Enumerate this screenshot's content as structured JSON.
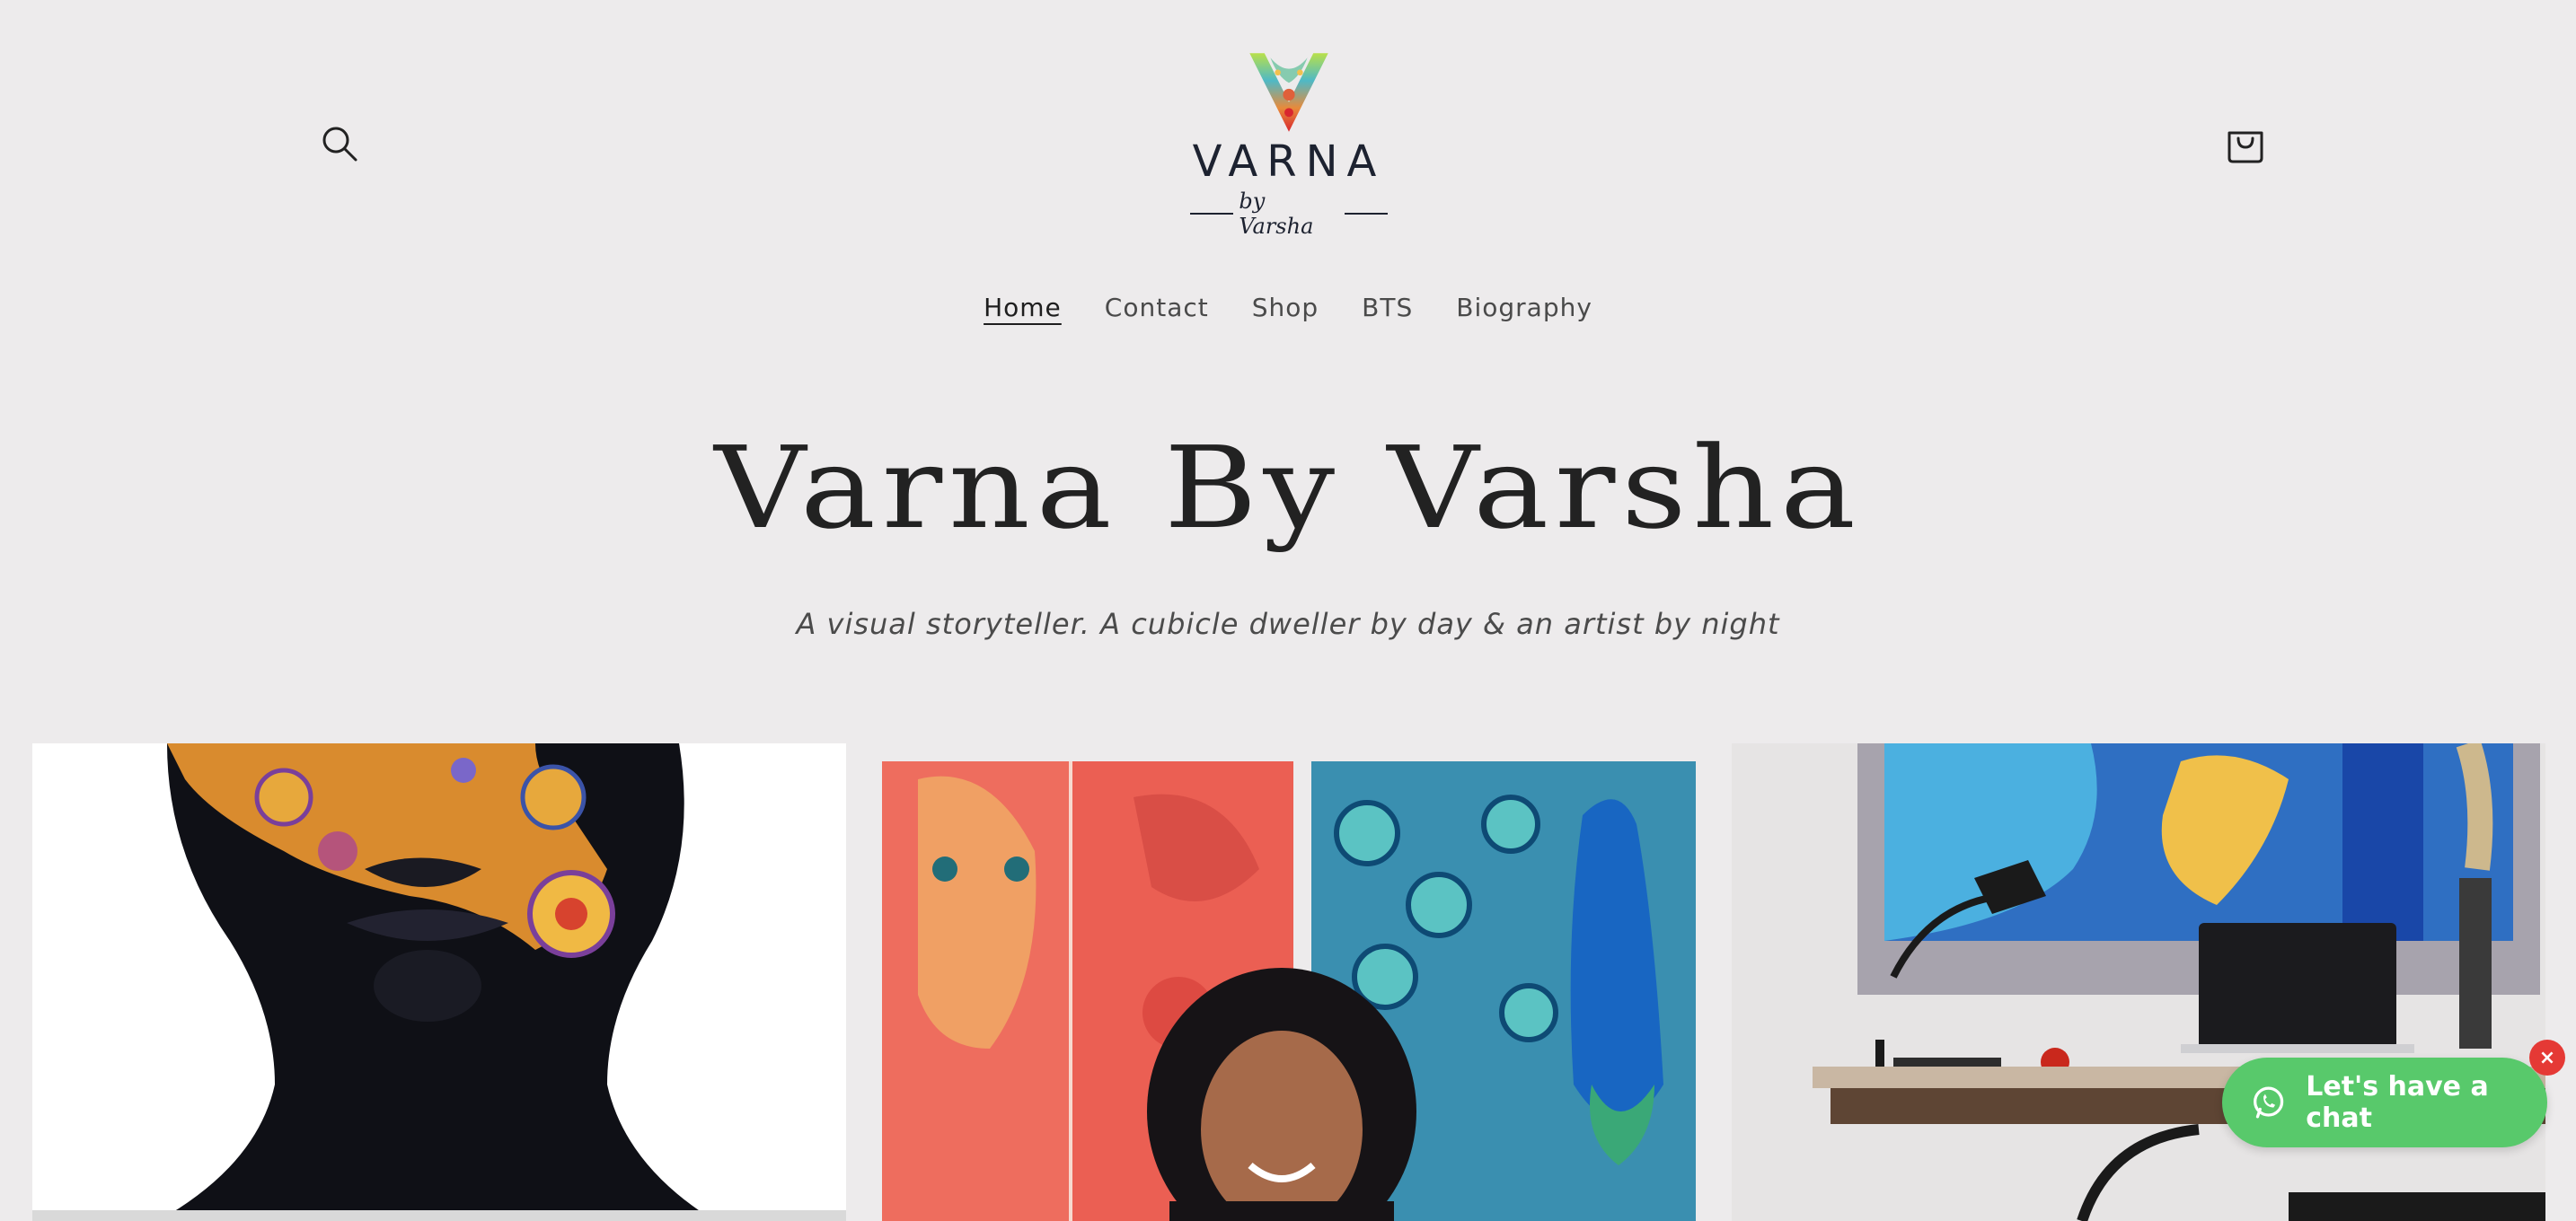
{
  "header": {
    "logo": {
      "wordmark": "VARNA",
      "tagline": "by Varsha"
    },
    "search_icon": "search-icon",
    "cart_icon": "cart-icon"
  },
  "nav": {
    "items": [
      {
        "label": "Home",
        "active": true
      },
      {
        "label": "Contact",
        "active": false
      },
      {
        "label": "Shop",
        "active": false
      },
      {
        "label": "BTS",
        "active": false
      },
      {
        "label": "Biography",
        "active": false
      }
    ]
  },
  "hero": {
    "title": "Varna By Varsha",
    "subtitle": "A visual storyteller. A cubicle dweller by day & an artist by night"
  },
  "gallery": {
    "items": [
      {
        "subject": "portrait-painting"
      },
      {
        "subject": "artist-with-paintings"
      },
      {
        "subject": "artwork-workspace"
      }
    ]
  },
  "chat_widget": {
    "label": "Let's have a chat",
    "close_glyph": "×",
    "color": "#58c96b",
    "close_color": "#e53935"
  },
  "colors": {
    "background": "#edebec",
    "text": "#222222"
  }
}
